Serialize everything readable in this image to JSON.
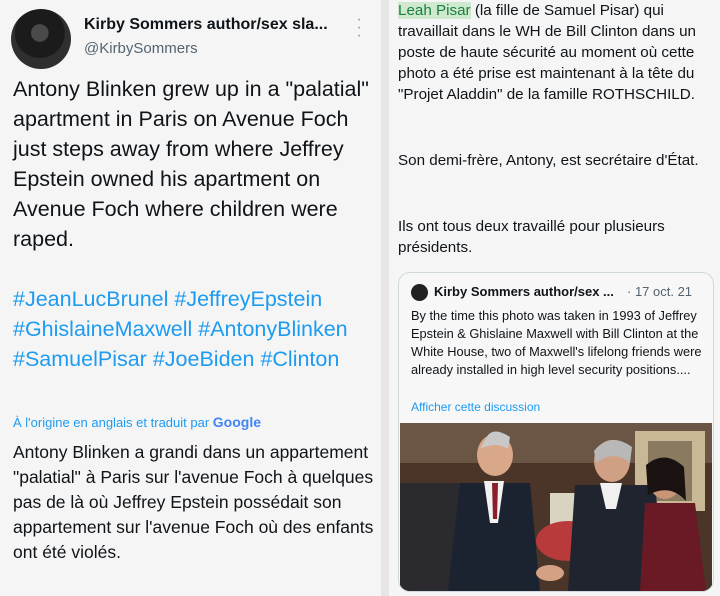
{
  "left": {
    "author": "Kirby Sommers author/sex sla...",
    "handle": "@KirbySommers",
    "more_icon": "ellipsis-vertical-icon",
    "tweet_text": "Antony Blinken grew up in a \"palatial\" apartment in Paris on Avenue Foch just steps away from where Jeffrey Epstein owned his apartment on Avenue Foch where children were raped.",
    "hashtags": [
      "#JeanLucBrunel",
      "#JeffreyEpstein",
      "#GhislaineMaxwell",
      "#AntonyBlinken",
      "#SamuelPisar",
      "#JoeBiden",
      "#Clinton"
    ],
    "translated_label": "À l'origine en anglais et traduit par",
    "translator": "Google",
    "translated_text": "Antony Blinken a grandi dans un appartement \"palatial\" à Paris sur l'avenue Foch à quelques pas de là où Jeffrey Epstein possédait son appartement sur l'avenue Foch où des enfants ont été violés."
  },
  "right": {
    "highlight": "Leah Pisar",
    "p1_rest": " (la fille de Samuel Pisar) qui travaillait dans le WH de Bill Clinton dans un poste de haute sécurité au moment où cette photo a été prise est maintenant à la tête du \"Projet Aladdin\" de la famille ROTHSCHILD.",
    "p2": "Son demi-frère, Antony, est secrétaire d'État.",
    "p3": "Ils ont tous deux travaillé pour plusieurs présidents.",
    "quote": {
      "author": "Kirby Sommers author/sex ...",
      "date": "· 17 oct. 21",
      "text": "By the time this photo was taken in 1993 of Jeffrey Epstein & Ghislaine Maxwell with Bill Clinton at the White House, two of Maxwell's lifelong friends were already installed in high level security positions....",
      "link": "Afficher cette discussion"
    }
  },
  "colors": {
    "link": "#1d9bf0",
    "highlight_bg": "#cfe9cf",
    "highlight_text": "#1a7f3d",
    "muted": "#536471"
  }
}
